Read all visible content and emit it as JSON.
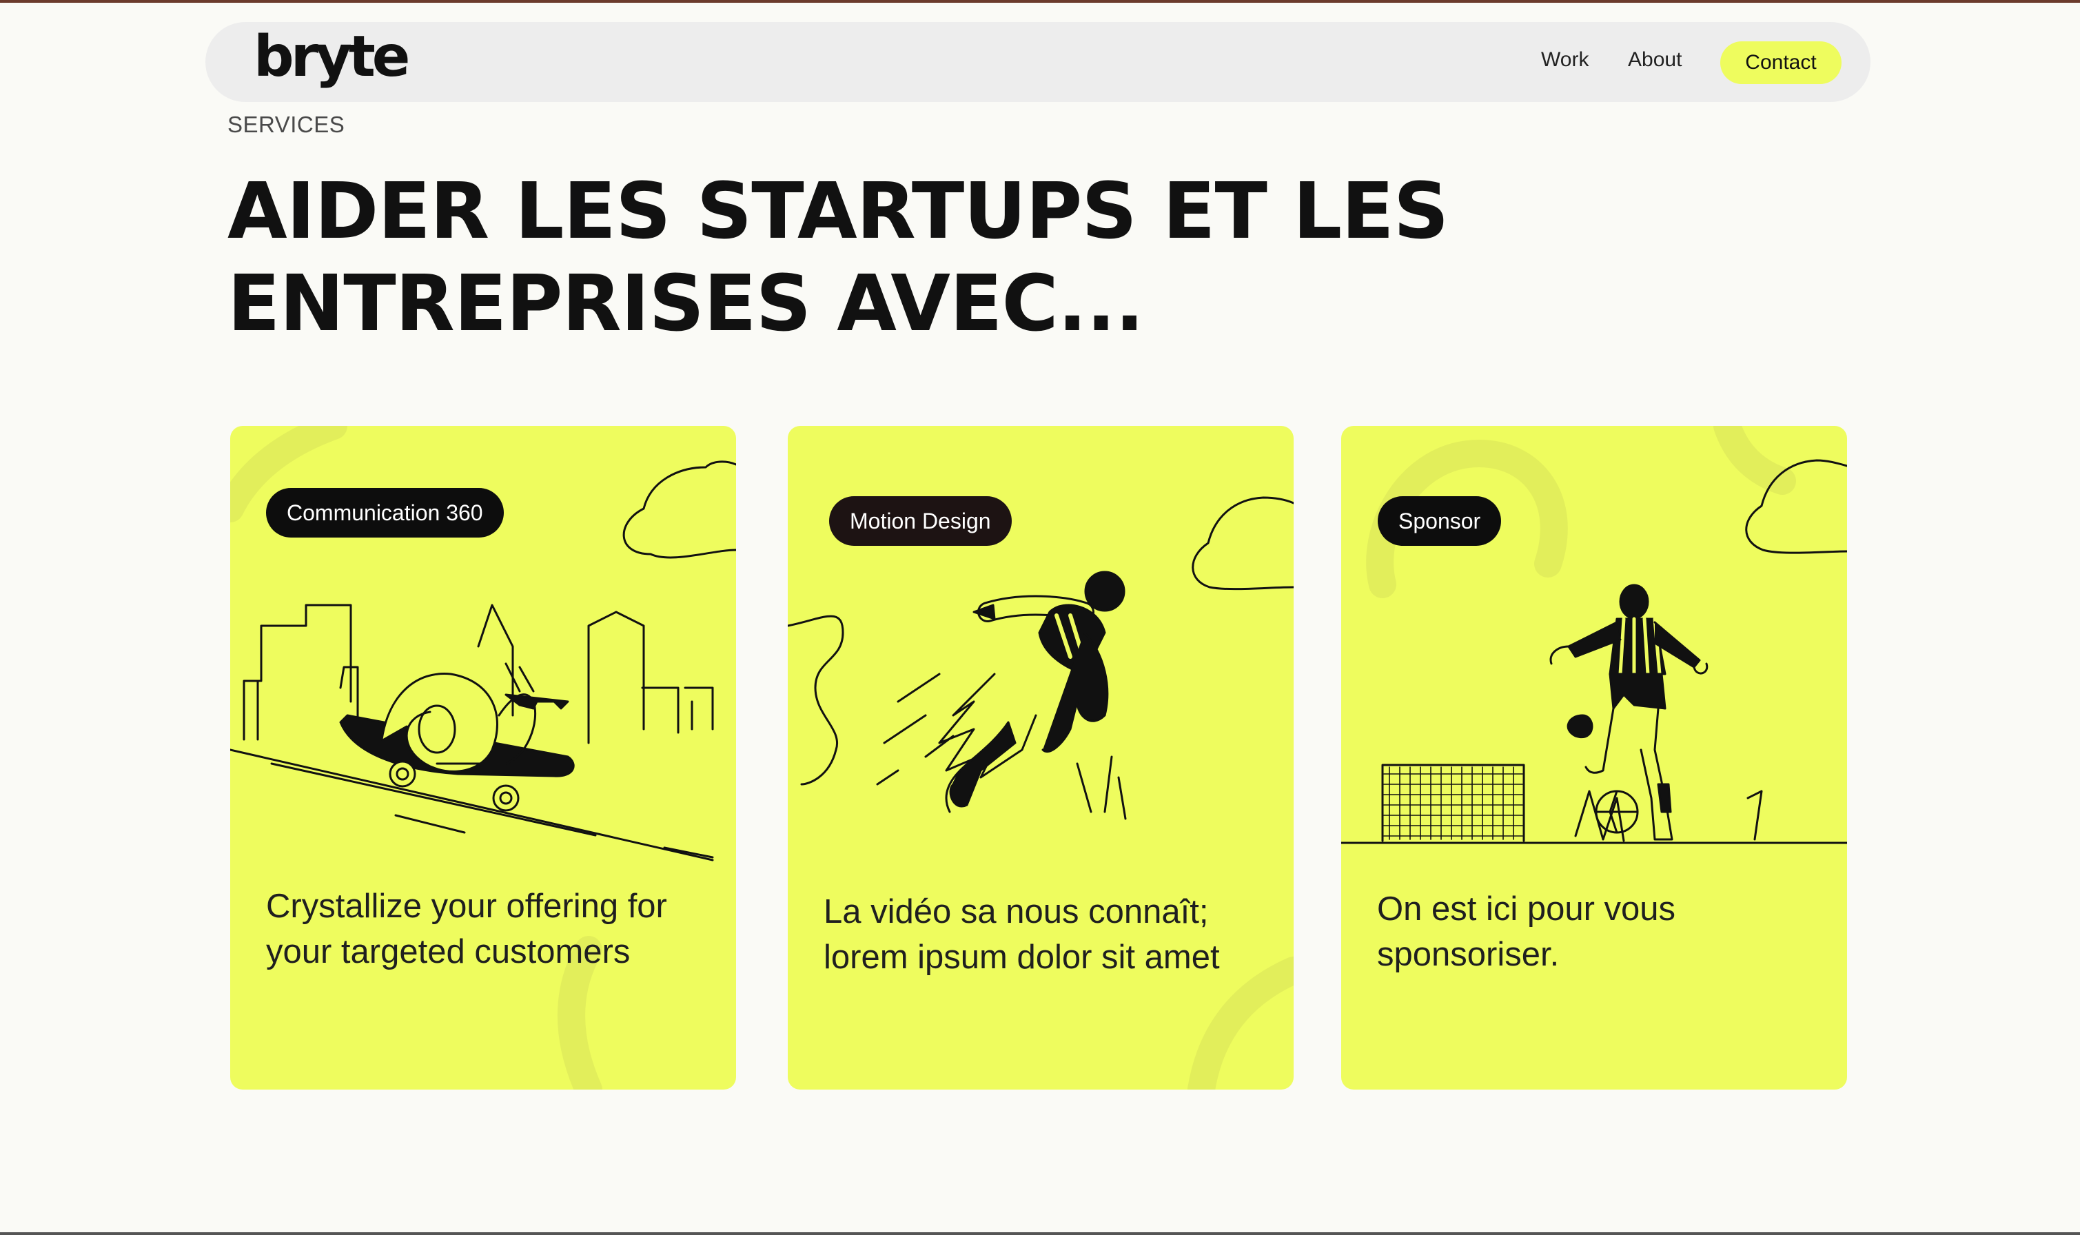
{
  "colors": {
    "accent": "#eefc5e",
    "tag_bg": "#0d0d0d",
    "page_bg": "#fafaf6",
    "nav_bg": "#ededed"
  },
  "brand": {
    "logo": "bryte"
  },
  "nav": {
    "items": [
      {
        "label": "Work"
      },
      {
        "label": "About"
      }
    ],
    "cta_label": "Contact"
  },
  "hero": {
    "eyebrow": "SERVICES",
    "title_line1": "AIDER LES STARTUPS ET LES",
    "title_line2": "ENTREPRISES AVEC..."
  },
  "cards": [
    {
      "tag": "Communication 360",
      "description": "Crystallize your offering for your targeted customers",
      "illustration": "snail-skateboard-city-illustration"
    },
    {
      "tag": "Motion Design",
      "description": "La vidéo sa nous connaît; lorem ipsum dolor sit amet",
      "illustration": "jetpack-person-illustration"
    },
    {
      "tag": "Sponsor",
      "description": "On est ici pour vous sponsoriser.",
      "illustration": "football-player-goal-illustration"
    }
  ]
}
